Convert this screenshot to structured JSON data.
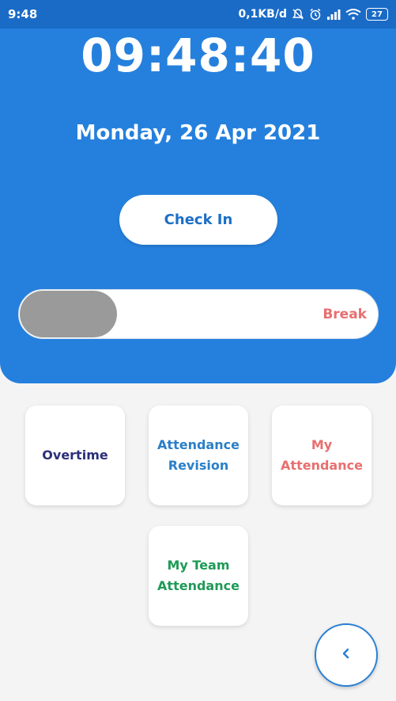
{
  "statusbar": {
    "time": "9:48",
    "net_speed": "0,1KB/d",
    "battery": "27"
  },
  "clock": {
    "time": "09:48:40",
    "date": "Monday, 26 Apr 2021"
  },
  "actions": {
    "check_in_label": "Check In",
    "break_label": "Break"
  },
  "menu": {
    "items": [
      {
        "label": "Overtime",
        "color": "#2b2f78"
      },
      {
        "label": "Attendance Revision",
        "color": "#2a7fc8"
      },
      {
        "label": "My Attendance",
        "color": "#e86f6f"
      },
      {
        "label": "My Team Attendance",
        "color": "#1f9a57"
      }
    ]
  },
  "fab": {
    "icon": "chevron-left-icon"
  },
  "colors": {
    "header": "#2580dd",
    "statusbar": "#1a6bc6",
    "knob": "#9a9a9a"
  }
}
